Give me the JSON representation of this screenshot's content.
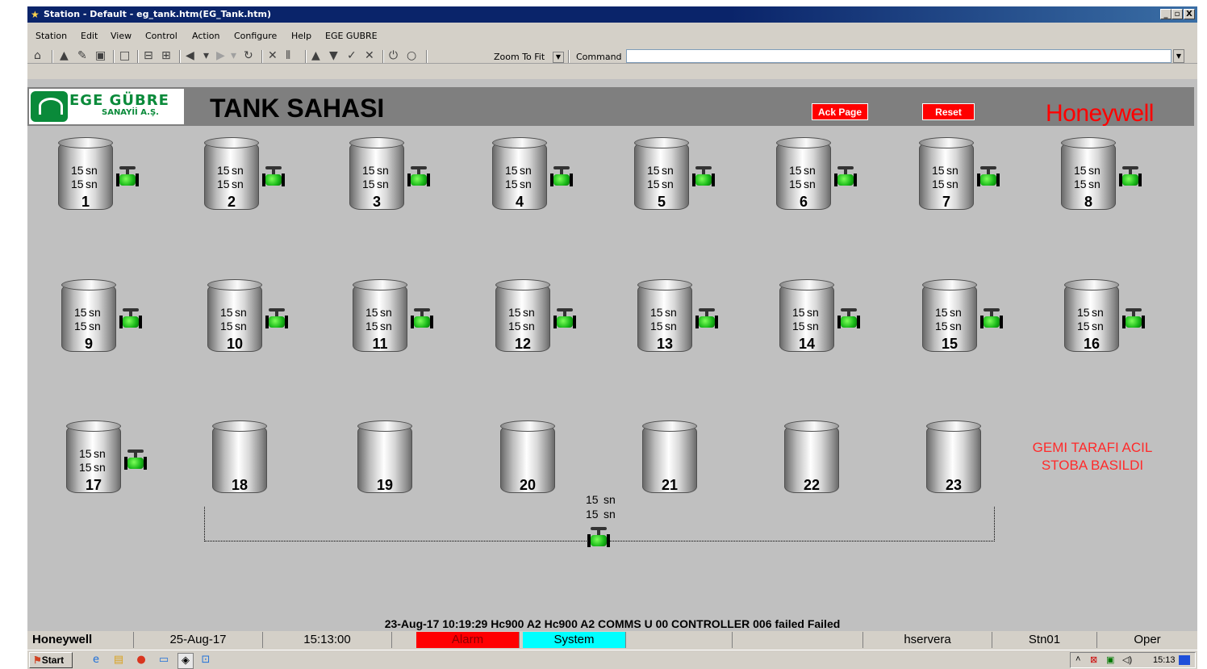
{
  "window": {
    "title": "Station - Default - eg_tank.htm(EG_Tank.htm)",
    "buttons": {
      "minimize": "_",
      "maximize": "▫",
      "close": "X"
    }
  },
  "menu": [
    "Station",
    "Edit",
    "View",
    "Control",
    "Action",
    "Configure",
    "Help",
    "EGE GUBRE"
  ],
  "toolbar": {
    "zoom_value": "Zoom To Fit",
    "command_label": "Command",
    "command_value": ""
  },
  "header": {
    "logo_line1": "EGE GÜBRE",
    "logo_line2": "SANAYİİ A.Ş.",
    "page_title": "TANK SAHASI",
    "ack_button": "Ack Page",
    "reset_button": "Reset",
    "brand": "Honeywell"
  },
  "tanks": [
    {
      "id": "1",
      "v1": "15",
      "v2": "15",
      "u1": "sn",
      "u2": "sn",
      "has_valve": true
    },
    {
      "id": "2",
      "v1": "15",
      "v2": "15",
      "u1": "sn",
      "u2": "sn",
      "has_valve": true
    },
    {
      "id": "3",
      "v1": "15",
      "v2": "15",
      "u1": "sn",
      "u2": "sn",
      "has_valve": true
    },
    {
      "id": "4",
      "v1": "15",
      "v2": "15",
      "u1": "sn",
      "u2": "sn",
      "has_valve": true
    },
    {
      "id": "5",
      "v1": "15",
      "v2": "15",
      "u1": "sn",
      "u2": "sn",
      "has_valve": true
    },
    {
      "id": "6",
      "v1": "15",
      "v2": "15",
      "u1": "sn",
      "u2": "sn",
      "has_valve": true
    },
    {
      "id": "7",
      "v1": "15",
      "v2": "15",
      "u1": "sn",
      "u2": "sn",
      "has_valve": true
    },
    {
      "id": "8",
      "v1": "15",
      "v2": "15",
      "u1": "sn",
      "u2": "sn",
      "has_valve": true
    },
    {
      "id": "9",
      "v1": "15",
      "v2": "15",
      "u1": "sn",
      "u2": "sn",
      "has_valve": true
    },
    {
      "id": "10",
      "v1": "15",
      "v2": "15",
      "u1": "sn",
      "u2": "sn",
      "has_valve": true
    },
    {
      "id": "11",
      "v1": "15",
      "v2": "15",
      "u1": "sn",
      "u2": "sn",
      "has_valve": true
    },
    {
      "id": "12",
      "v1": "15",
      "v2": "15",
      "u1": "sn",
      "u2": "sn",
      "has_valve": true
    },
    {
      "id": "13",
      "v1": "15",
      "v2": "15",
      "u1": "sn",
      "u2": "sn",
      "has_valve": true
    },
    {
      "id": "14",
      "v1": "15",
      "v2": "15",
      "u1": "sn",
      "u2": "sn",
      "has_valve": true
    },
    {
      "id": "15",
      "v1": "15",
      "v2": "15",
      "u1": "sn",
      "u2": "sn",
      "has_valve": true
    },
    {
      "id": "16",
      "v1": "15",
      "v2": "15",
      "u1": "sn",
      "u2": "sn",
      "has_valve": true
    },
    {
      "id": "17",
      "v1": "15",
      "v2": "15",
      "u1": "sn",
      "u2": "sn",
      "has_valve": true
    },
    {
      "id": "18",
      "has_valve": false
    },
    {
      "id": "19",
      "has_valve": false
    },
    {
      "id": "20",
      "has_valve": false
    },
    {
      "id": "21",
      "has_valve": false
    },
    {
      "id": "22",
      "has_valve": false
    },
    {
      "id": "23",
      "has_valve": false
    }
  ],
  "shared_valve": {
    "v1": "15",
    "v2": "15",
    "u1": "sn",
    "u2": "sn"
  },
  "alarm_text": {
    "line1": "GEMI TARAFI ACIL",
    "line2": "STOBA BASILDI"
  },
  "message_line": "23-Aug-17  10:19:29  Hc900 A2   Hc900 A2   COMMS    U 00 CONTROLLER 006 failed   Failed",
  "status_bar": {
    "brand": "Honeywell",
    "date": "25-Aug-17",
    "time": "15:13:00",
    "alarm": "Alarm",
    "system": "System",
    "server": "hservera",
    "station": "Stn01",
    "level": "Oper",
    "colors": {
      "alarm": "#ff0000",
      "system": "#00ffff"
    }
  },
  "taskbar": {
    "start": "Start",
    "clock": "15:13"
  }
}
